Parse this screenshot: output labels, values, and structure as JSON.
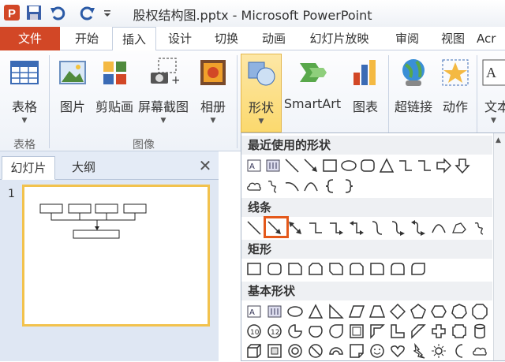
{
  "window": {
    "title": "股权结构图.pptx - Microsoft PowerPoint"
  },
  "qat": {
    "icons": [
      "powerpoint-icon",
      "save-icon",
      "undo-icon",
      "redo-icon",
      "customize-icon"
    ]
  },
  "tabs": [
    {
      "label": "文件"
    },
    {
      "label": "开始"
    },
    {
      "label": "插入"
    },
    {
      "label": "设计"
    },
    {
      "label": "切换"
    },
    {
      "label": "动画"
    },
    {
      "label": "幻灯片放映"
    },
    {
      "label": "审阅"
    },
    {
      "label": "视图"
    },
    {
      "label": "Acr"
    }
  ],
  "ribbon": {
    "buttons": [
      {
        "label": "表格"
      },
      {
        "label": "图片"
      },
      {
        "label": "剪贴画"
      },
      {
        "label": "屏幕截图"
      },
      {
        "label": "相册"
      },
      {
        "label": "形状"
      },
      {
        "label": "SmartArt"
      },
      {
        "label": "图表"
      },
      {
        "label": "超链接"
      },
      {
        "label": "动作"
      },
      {
        "label": "文本"
      }
    ],
    "groups": [
      "表格",
      "图像"
    ]
  },
  "panel": {
    "tabs": [
      "幻灯片",
      "大纲"
    ],
    "close": "✕",
    "slide_number": "1"
  },
  "gallery": {
    "sections": [
      "最近使用的形状",
      "线条",
      "矩形",
      "基本形状"
    ]
  },
  "colors": {
    "file_tab": "#d24726",
    "highlight": "#e4591b",
    "hot": "#fbd96e"
  }
}
